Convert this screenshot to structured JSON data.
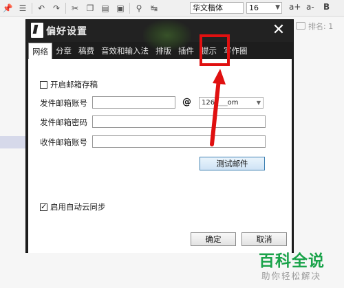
{
  "toolbar": {
    "font_name": "华文楷体",
    "font_size": "16",
    "bold_label": "B",
    "grow_label": "a+",
    "shrink_label": "a-"
  },
  "sidebar": {
    "rank_label": "排名: 1"
  },
  "dialog": {
    "title": "偏好设置",
    "close_glyph": "✕",
    "tabs": [
      {
        "label": "网络",
        "active": true
      },
      {
        "label": "分章"
      },
      {
        "label": "稿费"
      },
      {
        "label": "音效和输入法"
      },
      {
        "label": "排版"
      },
      {
        "label": "插件"
      },
      {
        "label": "提示"
      },
      {
        "label": "写作圈"
      }
    ],
    "network": {
      "enable_mailbox_label": "开启邮箱存稿",
      "enable_mailbox_checked": false,
      "sender_account_label": "发件邮箱账号",
      "sender_account_value": "",
      "at_sign": "@",
      "domain_value": "126.",
      "domain_value_tail": "om",
      "sender_password_label": "发件邮箱密码",
      "sender_password_value": "",
      "receiver_account_label": "收件邮箱账号",
      "receiver_account_value": "",
      "test_mail_button": "测试邮件",
      "auto_cloud_sync_label": "启用自动云同步",
      "auto_cloud_sync_checked": true
    },
    "ok_button": "确定",
    "cancel_button": "取消"
  },
  "watermark": {
    "title": "百科全说",
    "subtitle": "助你轻松解决"
  },
  "colors": {
    "dialog_bg": "#1d1d1d",
    "annotation_red": "#e01010",
    "watermark_green": "#1aa34a"
  }
}
